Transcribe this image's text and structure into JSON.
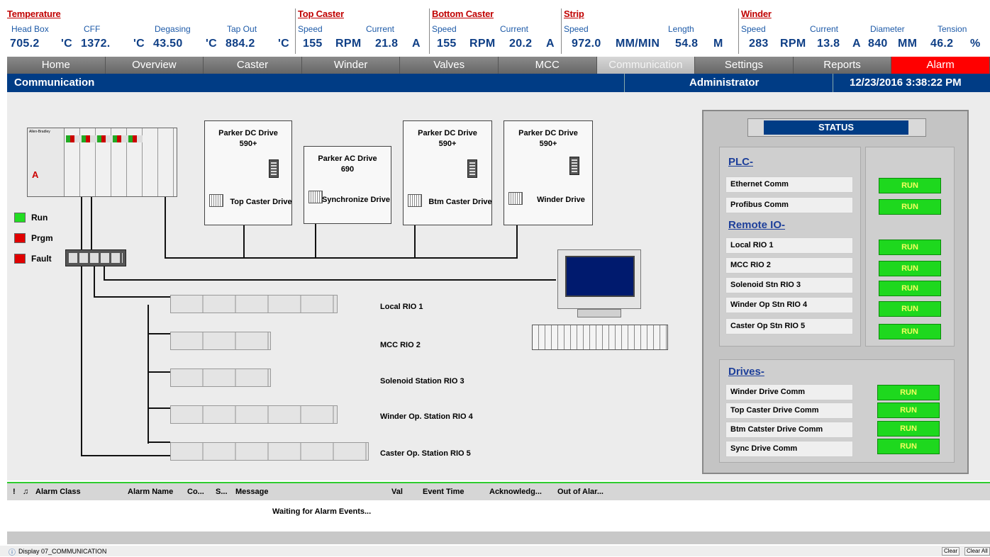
{
  "header": {
    "groups": [
      {
        "title": "Temperature",
        "labels": [
          "Head Box",
          "CFF",
          "Degasing",
          "Tap Out"
        ],
        "values": [
          "705.2",
          "'C",
          "1372.",
          "'C",
          "43.50",
          "'C",
          "884.2",
          "'C"
        ]
      },
      {
        "title": "Top Caster",
        "labels": [
          "Speed",
          "Current"
        ],
        "values": [
          "155",
          "RPM",
          "21.8",
          "A"
        ]
      },
      {
        "title": "Bottom Caster",
        "labels": [
          "Speed",
          "Current"
        ],
        "values": [
          "155",
          "RPM",
          "20.2",
          "A"
        ]
      },
      {
        "title": "Strip",
        "labels": [
          "Speed",
          "Length"
        ],
        "values": [
          "972.0",
          "MM/MIN",
          "54.8",
          "M"
        ]
      },
      {
        "title": "Winder",
        "labels": [
          "Speed",
          "Current",
          "Diameter",
          "Tension"
        ],
        "values": [
          "283",
          "RPM",
          "13.8",
          "A",
          "840",
          "MM",
          "46.2",
          "%"
        ]
      }
    ]
  },
  "nav": [
    "Home",
    "Overview",
    "Caster",
    "Winder",
    "Valves",
    "MCC",
    "Communication",
    "Settings",
    "Reports",
    "Alarm"
  ],
  "titlebar": {
    "page": "Communication",
    "user": "Administrator",
    "datetime": "12/23/2016 3:38:22 PM"
  },
  "plc": {
    "brand": "Allen-Bradley",
    "logo": "A",
    "legend": [
      "Run",
      "Prgm",
      "Fault"
    ]
  },
  "drives": [
    {
      "title": "Parker DC Drive",
      "model": "590+",
      "name": "Top Caster Drive"
    },
    {
      "title": "Parker AC Drive",
      "model": "690",
      "name": "Synchronize Drive"
    },
    {
      "title": "Parker DC Drive",
      "model": "590+",
      "name": "Btm Caster Drive"
    },
    {
      "title": "Parker DC Drive",
      "model": "590+",
      "name": "Winder Drive"
    }
  ],
  "rio": [
    "Local RIO 1",
    "MCC RIO 2",
    "Solenoid Station RIO 3",
    "Winder Op. Station RIO 4",
    "Caster Op. Station RIO 5"
  ],
  "status": {
    "title": "STATUS",
    "plc_title": "PLC-",
    "plc_rows": [
      {
        "label": "Ethernet Comm",
        "state": "RUN"
      },
      {
        "label": "Profibus Comm",
        "state": "RUN"
      }
    ],
    "rio_title": "Remote IO-",
    "rio_rows": [
      {
        "label": "Local RIO 1",
        "state": "RUN"
      },
      {
        "label": "MCC RIO 2",
        "state": "RUN"
      },
      {
        "label": "Solenoid Stn RIO 3",
        "state": "RUN"
      },
      {
        "label": "Winder Op Stn RIO 4",
        "state": "RUN"
      },
      {
        "label": "Caster Op Stn RIO 5",
        "state": "RUN"
      }
    ],
    "drives_title": "Drives-",
    "drive_rows": [
      {
        "label": "Winder Drive Comm",
        "state": "RUN"
      },
      {
        "label": "Top Caster Drive Comm",
        "state": "RUN"
      },
      {
        "label": "Btm Catster Drive Comm",
        "state": "RUN"
      },
      {
        "label": "Sync Drive Comm",
        "state": "RUN"
      }
    ]
  },
  "alarms": {
    "columns": [
      "!",
      "Alarm Class",
      "Alarm Name",
      "Co...",
      "S...",
      "Message",
      "Val",
      "Event Time",
      "Acknowledg...",
      "Out of Alar..."
    ],
    "message": "Waiting for Alarm Events..."
  },
  "statusbar": {
    "display": "Display 07_COMMUNICATION",
    "clear": "Clear",
    "clear_all": "Clear All"
  }
}
